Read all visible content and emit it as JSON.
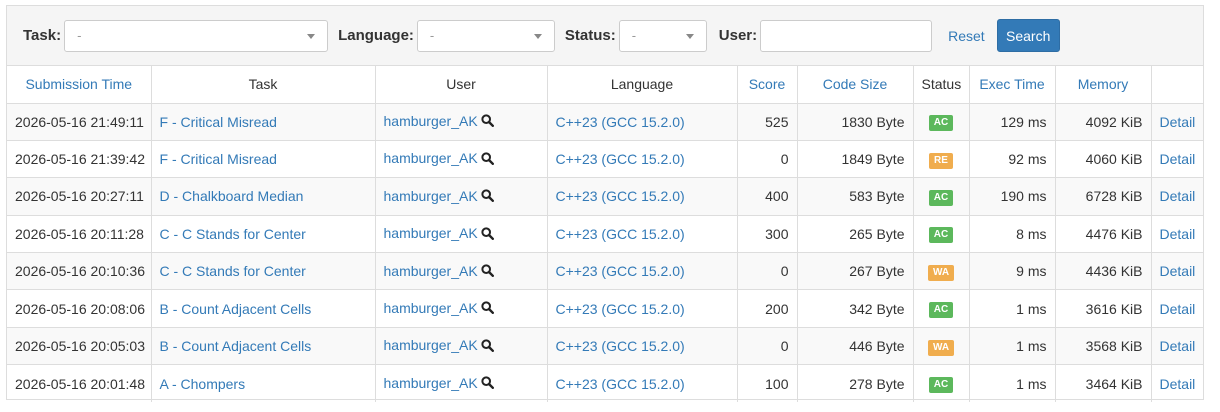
{
  "filters": {
    "task_label": "Task:",
    "task_value": "-",
    "language_label": "Language:",
    "language_value": "-",
    "status_label": "Status:",
    "status_value": "-",
    "user_label": "User:",
    "user_value": "",
    "reset_label": "Reset",
    "search_label": "Search"
  },
  "columns": [
    "Submission Time",
    "Task",
    "User",
    "Language",
    "Score",
    "Code Size",
    "Status",
    "Exec Time",
    "Memory",
    ""
  ],
  "rows": [
    {
      "time": "2026-05-16 21:49:11",
      "task": "F - Critical Misread",
      "user": "hamburger_AK",
      "lang": "C++23 (GCC 15.2.0)",
      "score": "525",
      "size": "1830 Byte",
      "status": "AC",
      "exec": "129 ms",
      "mem": "4092 KiB",
      "detail": "Detail"
    },
    {
      "time": "2026-05-16 21:39:42",
      "task": "F - Critical Misread",
      "user": "hamburger_AK",
      "lang": "C++23 (GCC 15.2.0)",
      "score": "0",
      "size": "1849 Byte",
      "status": "RE",
      "exec": "92 ms",
      "mem": "4060 KiB",
      "detail": "Detail"
    },
    {
      "time": "2026-05-16 20:27:11",
      "task": "D - Chalkboard Median",
      "user": "hamburger_AK",
      "lang": "C++23 (GCC 15.2.0)",
      "score": "400",
      "size": "583 Byte",
      "status": "AC",
      "exec": "190 ms",
      "mem": "6728 KiB",
      "detail": "Detail"
    },
    {
      "time": "2026-05-16 20:11:28",
      "task": "C - C Stands for Center",
      "user": "hamburger_AK",
      "lang": "C++23 (GCC 15.2.0)",
      "score": "300",
      "size": "265 Byte",
      "status": "AC",
      "exec": "8 ms",
      "mem": "4476 KiB",
      "detail": "Detail"
    },
    {
      "time": "2026-05-16 20:10:36",
      "task": "C - C Stands for Center",
      "user": "hamburger_AK",
      "lang": "C++23 (GCC 15.2.0)",
      "score": "0",
      "size": "267 Byte",
      "status": "WA",
      "exec": "9 ms",
      "mem": "4436 KiB",
      "detail": "Detail"
    },
    {
      "time": "2026-05-16 20:08:06",
      "task": "B - Count Adjacent Cells",
      "user": "hamburger_AK",
      "lang": "C++23 (GCC 15.2.0)",
      "score": "200",
      "size": "342 Byte",
      "status": "AC",
      "exec": "1 ms",
      "mem": "3616 KiB",
      "detail": "Detail"
    },
    {
      "time": "2026-05-16 20:05:03",
      "task": "B - Count Adjacent Cells",
      "user": "hamburger_AK",
      "lang": "C++23 (GCC 15.2.0)",
      "score": "0",
      "size": "446 Byte",
      "status": "WA",
      "exec": "1 ms",
      "mem": "3568 KiB",
      "detail": "Detail"
    },
    {
      "time": "2026-05-16 20:01:48",
      "task": "A - Chompers",
      "user": "hamburger_AK",
      "lang": "C++23 (GCC 15.2.0)",
      "score": "100",
      "size": "278 Byte",
      "status": "AC",
      "exec": "1 ms",
      "mem": "3464 KiB",
      "detail": "Detail"
    }
  ],
  "status_colors": {
    "AC": "#5cb85c",
    "RE": "#f0ad4e",
    "WA": "#f0ad4e"
  },
  "icons": {
    "user_search": "magnifier-icon",
    "select_caret": "caret-down-icon"
  }
}
